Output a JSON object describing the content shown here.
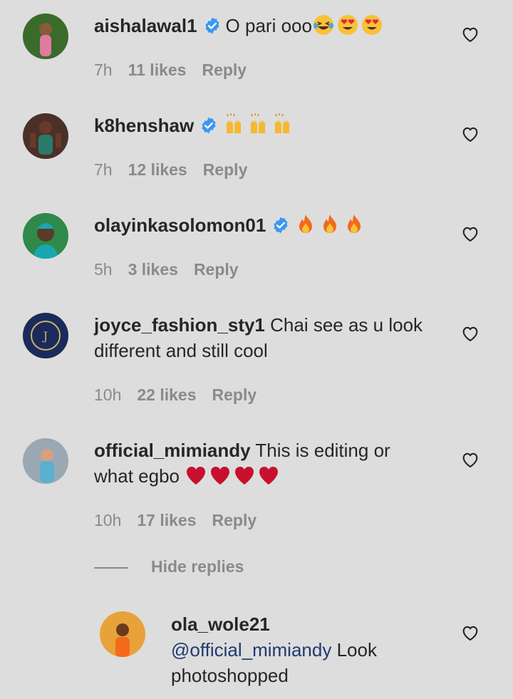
{
  "comments": [
    {
      "username": "aishalawal1",
      "verified": true,
      "text": "O pari ooo",
      "emojis": [
        "laughing-tears",
        "heart-eyes",
        "heart-eyes"
      ],
      "time": "7h",
      "likes": "11 likes",
      "reply": "Reply",
      "avatar_color": "#3a6b2a"
    },
    {
      "username": "k8henshaw",
      "verified": true,
      "text": "",
      "emojis": [
        "raised-hands",
        "raised-hands",
        "raised-hands"
      ],
      "time": "7h",
      "likes": "12 likes",
      "reply": "Reply",
      "avatar_color": "#4a3028"
    },
    {
      "username": "olayinkasolomon01",
      "verified": true,
      "text": "",
      "emojis": [
        "fire",
        "fire",
        "fire"
      ],
      "time": "5h",
      "likes": "3 likes",
      "reply": "Reply",
      "avatar_color": "#2e8a4a"
    },
    {
      "username": "joyce_fashion_sty1",
      "verified": false,
      "text_line1": "Chai see as u look",
      "text_line2": "different and still cool",
      "time": "10h",
      "likes": "22 likes",
      "reply": "Reply",
      "avatar_color": "#1a2a5a"
    },
    {
      "username": "official_mimiandy",
      "verified": false,
      "text_line1": "This is editing or",
      "text_line2": "what egbo",
      "emojis": [
        "red-heart",
        "red-heart",
        "red-heart",
        "red-heart"
      ],
      "time": "10h",
      "likes": "17 likes",
      "reply": "Reply",
      "avatar_color": "#9aa8b4"
    }
  ],
  "hide_replies": "Hide replies",
  "reply_comment": {
    "username": "ola_wole21",
    "mention": "@official_mimiandy",
    "text_after_mention": "Look",
    "text_line2": "photoshopped",
    "avatar_color": "#e8a23a"
  },
  "colors": {
    "background": "#dddddd",
    "verified_blue": "#3897f0",
    "meta_grey": "#8a8a8a",
    "mention_blue": "#1f3a70"
  }
}
